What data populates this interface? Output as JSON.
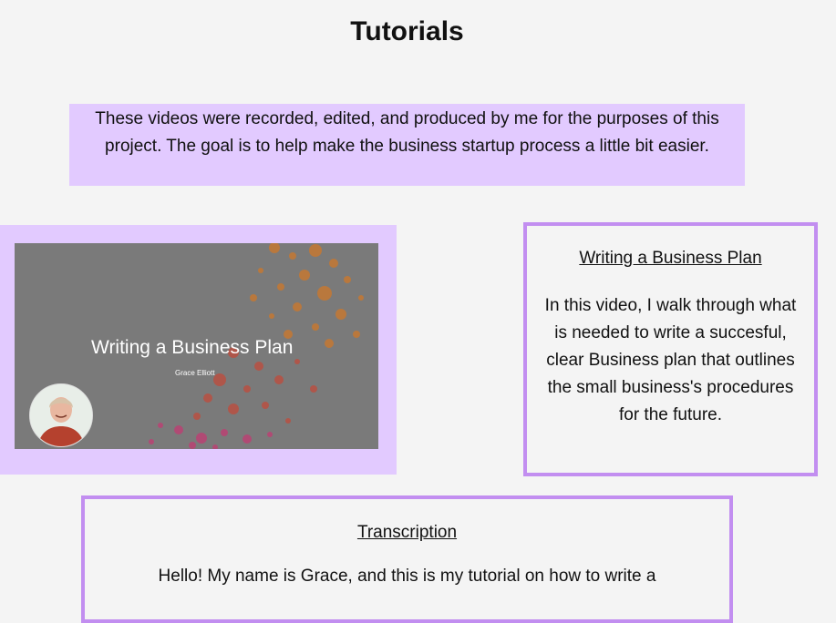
{
  "page": {
    "title": "Tutorials",
    "intro": "These videos were recorded, edited, and produced by me for the purposes of this project. The goal is to help make the business startup process a little bit easier."
  },
  "video": {
    "slide_title": "Writing a Business Plan",
    "slide_author": "Grace Elliott"
  },
  "description_card": {
    "heading": "Writing a Business Plan",
    "body": "In this video, I walk through what is needed to write a succesful, clear Business plan that outlines the small business's procedures for the future."
  },
  "transcription": {
    "heading": "Transcription",
    "body": "Hello! My name is Grace, and this is my tutorial on how to write a"
  }
}
